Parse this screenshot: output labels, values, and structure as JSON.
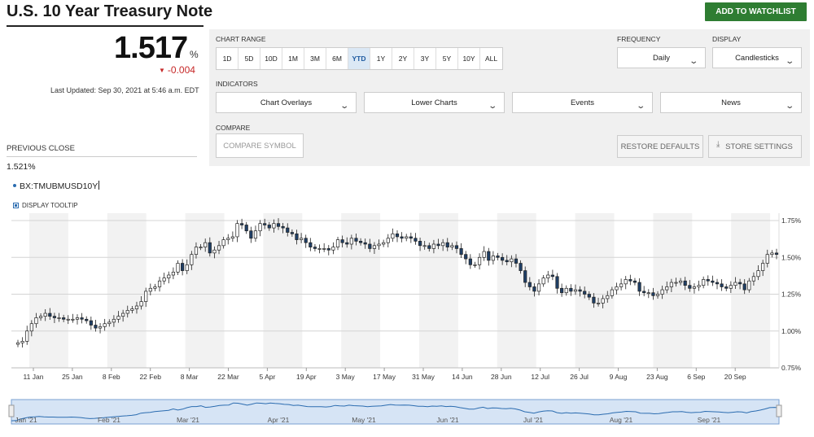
{
  "header": {
    "title": "U.S. 10 Year Treasury Note",
    "watchlist_button": "ADD TO WATCHLIST"
  },
  "quote": {
    "price": "1.517",
    "unit": "%",
    "change": "-0.004",
    "last_updated": "Last Updated: Sep 30, 2021 at 5:46 a.m. EDT",
    "previous_close_label": "PREVIOUS CLOSE",
    "previous_close": "1.521%",
    "symbol": "BX:TMUBMUSD10Y",
    "display_tooltip_label": "DISPLAY TOOLTIP"
  },
  "controls": {
    "chart_range_label": "CHART RANGE",
    "ranges": [
      "1D",
      "5D",
      "10D",
      "1M",
      "3M",
      "6M",
      "YTD",
      "1Y",
      "2Y",
      "3Y",
      "5Y",
      "10Y",
      "ALL"
    ],
    "active_range": "YTD",
    "frequency_label": "FREQUENCY",
    "frequency": "Daily",
    "display_label": "DISPLAY",
    "display": "Candlesticks",
    "indicators_label": "INDICATORS",
    "indicator_dropdowns": [
      "Chart Overlays",
      "Lower Charts",
      "Events",
      "News"
    ],
    "compare_label": "COMPARE",
    "compare_placeholder": "COMPARE SYMBOL",
    "restore_defaults": "RESTORE DEFAULTS",
    "store_settings": "STORE SETTINGS"
  },
  "colors": {
    "accent_green": "#2e7d32",
    "negative_red": "#c62828",
    "nav_blue": "#2b6cb0"
  },
  "icons": {
    "change_direction": "triangle-down-icon",
    "dropdown": "chevron-down-icon",
    "store_settings": "download-icon"
  },
  "chart_data": {
    "type": "candlestick",
    "frequency": "daily",
    "ylim": [
      0.75,
      1.8
    ],
    "y_ticks": [
      "1.75%",
      "1.50%",
      "1.25%",
      "1.00%",
      "0.75%"
    ],
    "x_ticks": [
      "11 Jan",
      "25 Jan",
      "8 Feb",
      "22 Feb",
      "8 Mar",
      "22 Mar",
      "5 Apr",
      "19 Apr",
      "3 May",
      "17 May",
      "31 May",
      "14 Jun",
      "28 Jun",
      "12 Jul",
      "26 Jul",
      "9 Aug",
      "23 Aug",
      "6 Sep",
      "20 Sep"
    ],
    "grid": true,
    "close_series": [
      0.92,
      0.93,
      1.0,
      1.05,
      1.09,
      1.1,
      1.12,
      1.1,
      1.09,
      1.09,
      1.08,
      1.08,
      1.08,
      1.09,
      1.08,
      1.07,
      1.04,
      1.02,
      1.03,
      1.05,
      1.06,
      1.08,
      1.1,
      1.12,
      1.14,
      1.15,
      1.17,
      1.2,
      1.27,
      1.29,
      1.3,
      1.34,
      1.36,
      1.38,
      1.4,
      1.46,
      1.41,
      1.45,
      1.52,
      1.57,
      1.57,
      1.6,
      1.53,
      1.55,
      1.58,
      1.62,
      1.63,
      1.64,
      1.73,
      1.72,
      1.68,
      1.63,
      1.68,
      1.73,
      1.72,
      1.7,
      1.73,
      1.71,
      1.7,
      1.67,
      1.66,
      1.62,
      1.63,
      1.6,
      1.57,
      1.56,
      1.56,
      1.56,
      1.55,
      1.57,
      1.62,
      1.6,
      1.59,
      1.63,
      1.61,
      1.6,
      1.59,
      1.56,
      1.58,
      1.59,
      1.6,
      1.63,
      1.66,
      1.64,
      1.63,
      1.64,
      1.63,
      1.61,
      1.58,
      1.58,
      1.56,
      1.59,
      1.58,
      1.6,
      1.57,
      1.58,
      1.56,
      1.52,
      1.49,
      1.45,
      1.45,
      1.5,
      1.54,
      1.48,
      1.51,
      1.5,
      1.48,
      1.47,
      1.49,
      1.46,
      1.41,
      1.33,
      1.3,
      1.27,
      1.32,
      1.36,
      1.38,
      1.37,
      1.29,
      1.26,
      1.29,
      1.27,
      1.28,
      1.27,
      1.25,
      1.23,
      1.19,
      1.19,
      1.22,
      1.24,
      1.28,
      1.3,
      1.32,
      1.35,
      1.34,
      1.33,
      1.27,
      1.26,
      1.26,
      1.24,
      1.25,
      1.28,
      1.3,
      1.33,
      1.33,
      1.34,
      1.31,
      1.29,
      1.3,
      1.31,
      1.35,
      1.34,
      1.33,
      1.32,
      1.3,
      1.29,
      1.31,
      1.33,
      1.32,
      1.28,
      1.34,
      1.37,
      1.41,
      1.46,
      1.52,
      1.53,
      1.52
    ],
    "x_range": [
      "Jan '21",
      "Sep '21"
    ],
    "navigator_ticks": [
      "Jan '21",
      "Feb '21",
      "Mar '21",
      "Apr '21",
      "May '21",
      "Jun '21",
      "Jul '21",
      "Aug '21",
      "Sep '21"
    ]
  }
}
